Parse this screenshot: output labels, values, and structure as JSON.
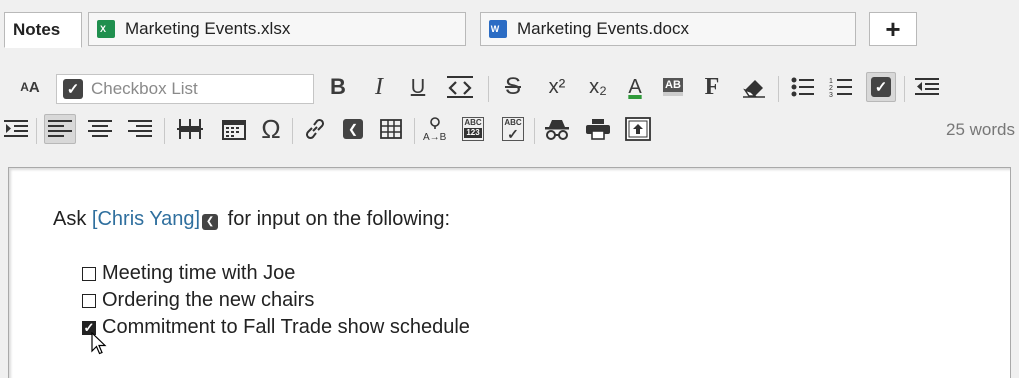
{
  "tabs": [
    {
      "label": "Notes",
      "active": true
    },
    {
      "label": "Marketing Events.xlsx",
      "icon": "excel-icon",
      "icon_letter": "X"
    },
    {
      "label": "Marketing Events.docx",
      "icon": "word-icon",
      "icon_letter": "W"
    }
  ],
  "add_tab": "+",
  "toolbar": {
    "font_size_glyph": "AA",
    "style_value": "Checkbox List",
    "bold": "B",
    "italic": "I",
    "underline": "U",
    "strikethrough": "S",
    "superscript": "x²",
    "subscript": "x₂",
    "font_color": "A",
    "highlight": "AB",
    "font": "F",
    "omega": "Ω",
    "spell_top": "ABC",
    "spell_mid": "123",
    "word_count": "25 words"
  },
  "editor": {
    "intro_prefix": "Ask ",
    "mention": "[Chris Yang]",
    "intro_suffix": " for input on the following:",
    "items": [
      {
        "text": "Meeting time with Joe",
        "checked": false
      },
      {
        "text": "Ordering the new chairs",
        "checked": false
      },
      {
        "text": "Commitment to Fall Trade show schedule",
        "checked": true
      }
    ]
  },
  "colors": {
    "mention": "#2f6f9e",
    "excel": "#1f8f4e",
    "word": "#2b6cc4"
  }
}
